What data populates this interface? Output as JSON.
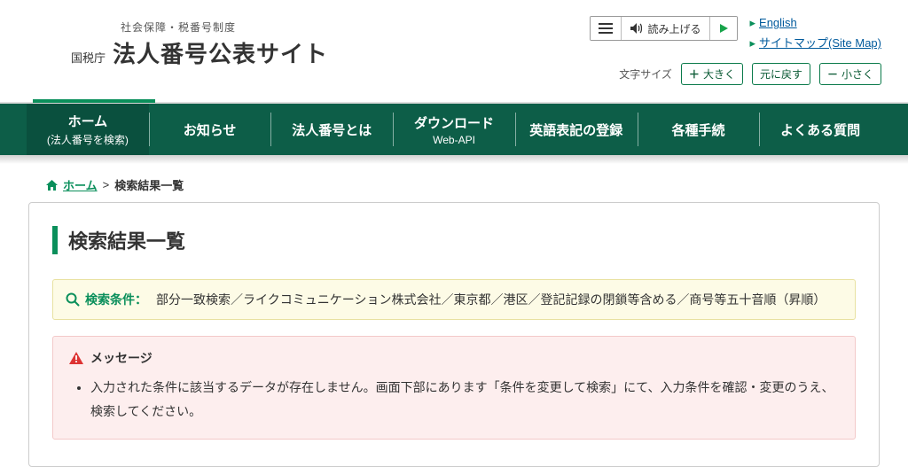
{
  "header": {
    "sup": "社会保障・税番号制度",
    "agency": "国税庁",
    "title": "法人番号公表サイト",
    "speak_label": "読み上げる",
    "links": {
      "english": "English",
      "sitemap": "サイトマップ(Site Map)"
    },
    "font_size": {
      "label": "文字サイズ",
      "larger": "大きく",
      "reset": "元に戻す",
      "smaller": "小さく"
    }
  },
  "nav": {
    "items": [
      {
        "line1": "ホーム",
        "line2": "(法人番号を検索)"
      },
      {
        "line1": "お知らせ",
        "line2": ""
      },
      {
        "line1": "法人番号とは",
        "line2": ""
      },
      {
        "line1": "ダウンロード",
        "line2": "Web-API"
      },
      {
        "line1": "英語表記の登録",
        "line2": ""
      },
      {
        "line1": "各種手続",
        "line2": ""
      },
      {
        "line1": "よくある質問",
        "line2": ""
      }
    ]
  },
  "breadcrumb": {
    "home": "ホーム",
    "sep": ">",
    "current": "検索結果一覧"
  },
  "page": {
    "title": "検索結果一覧",
    "cond_label": "検索条件：",
    "cond_text": "部分一致検索／ライクコミュニケーション株式会社／東京都／港区／登記記録の閉鎖等含める／商号等五十音順（昇順）",
    "msg_head": "メッセージ",
    "msg_item": "入力された条件に該当するデータが存在しません。画面下部にあります「条件を変更して検索」にて、入力条件を確認・変更のうえ、検索してください。"
  }
}
